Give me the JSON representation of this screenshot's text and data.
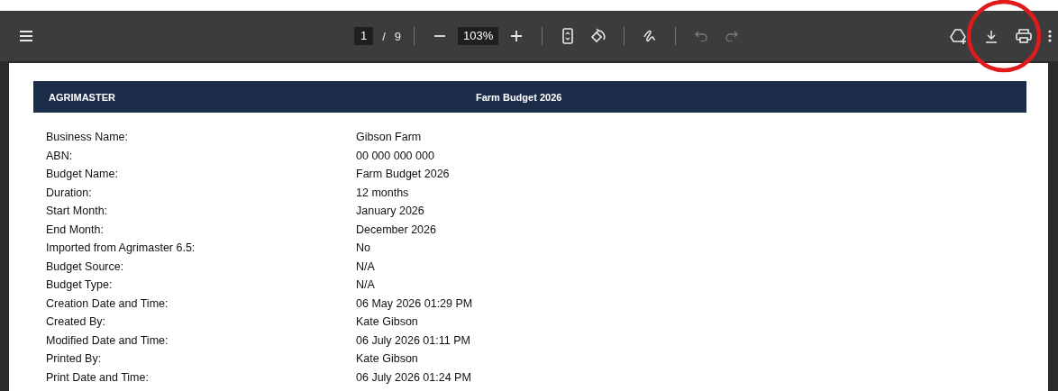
{
  "toolbar": {
    "page_current": "1",
    "page_separator": "/",
    "page_total": "9",
    "zoom": "103%",
    "undo_disabled": true,
    "redo_disabled": true
  },
  "annotation": {
    "kind": "circle",
    "color": "#e01b1b"
  },
  "document": {
    "brand": "AGRIMASTER",
    "title": "Farm Budget 2026",
    "fields": [
      {
        "label": "Business Name:",
        "value": "Gibson Farm"
      },
      {
        "label": "ABN:",
        "value": "00 000 000 000"
      },
      {
        "label": "Budget Name:",
        "value": "Farm Budget 2026"
      },
      {
        "label": "Duration:",
        "value": "12 months"
      },
      {
        "label": "Start Month:",
        "value": "January 2026"
      },
      {
        "label": "End Month:",
        "value": "December 2026"
      },
      {
        "label": "Imported from Agrimaster 6.5:",
        "value": "No"
      },
      {
        "label": "Budget Source:",
        "value": "N/A"
      },
      {
        "label": "Budget Type:",
        "value": "N/A"
      },
      {
        "label": "Creation Date and Time:",
        "value": "06 May 2026 01:29 PM"
      },
      {
        "label": "Created By:",
        "value": "Kate Gibson"
      },
      {
        "label": "Modified Date and Time:",
        "value": "06 July 2026 01:11 PM"
      },
      {
        "label": "Printed By:",
        "value": "Kate Gibson"
      },
      {
        "label": "Print Date and Time:",
        "value": "06 July 2026 01:24 PM"
      }
    ]
  }
}
